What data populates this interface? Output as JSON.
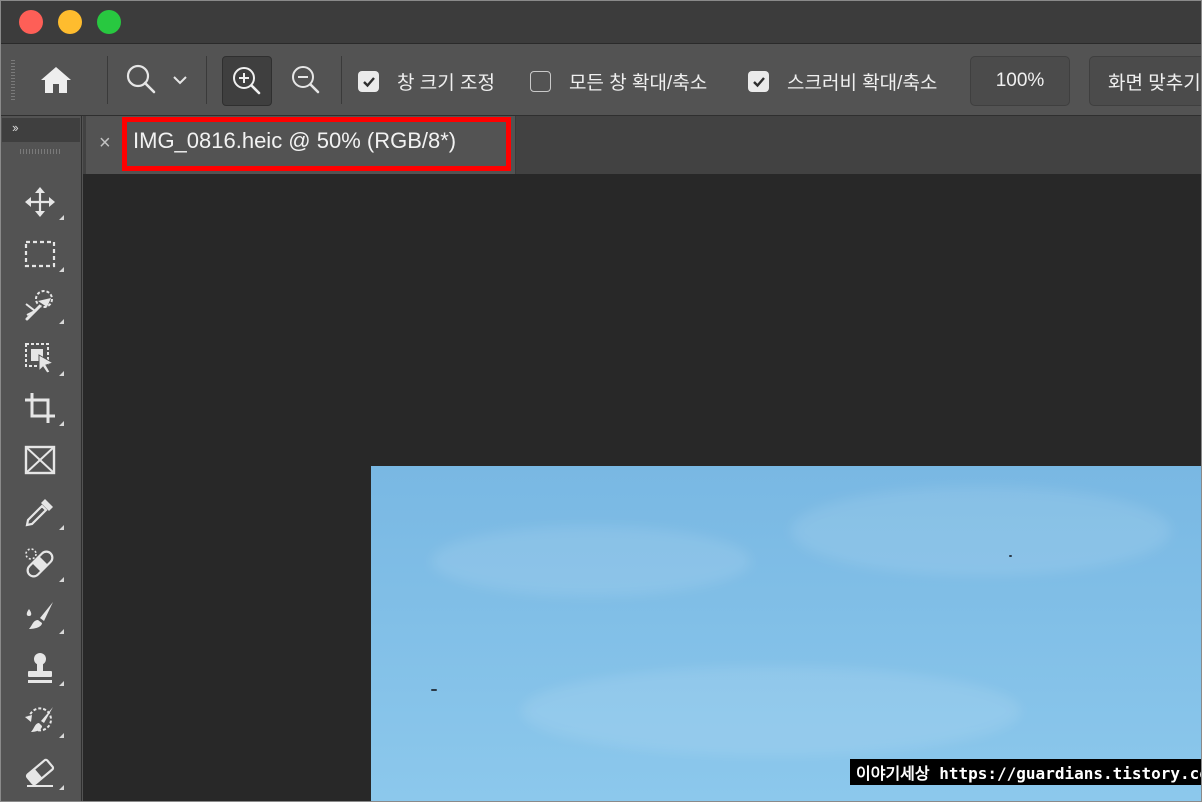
{
  "window": {
    "traffic_lights": [
      "close",
      "minimize",
      "maximize"
    ]
  },
  "options_bar": {
    "home_icon": "home-icon",
    "zoom_tool_icon": "magnifier-icon",
    "zoom_in_icon": "zoom-in-icon",
    "zoom_out_icon": "zoom-out-icon",
    "resize_windows_label": "창 크기 조정",
    "resize_windows_checked": true,
    "zoom_all_label": "모든 창 확대/축소",
    "zoom_all_checked": false,
    "scrubby_zoom_label": "스크러비 확대/축소",
    "scrubby_zoom_checked": true,
    "zoom_level_button": "100%",
    "fit_screen_button": "화면 맞추기"
  },
  "toolbar": {
    "collapse_label": "››",
    "tools": [
      "move-icon",
      "marquee-icon",
      "quick-selection-icon",
      "object-selection-icon",
      "crop-icon",
      "frame-icon",
      "eyedropper-icon",
      "healing-brush-icon",
      "brush-icon",
      "clone-stamp-icon",
      "history-brush-icon",
      "eraser-icon"
    ]
  },
  "document": {
    "tab_title": "IMG_0816.heic @ 50% (RGB/8*)",
    "tab_close": "×"
  },
  "watermark": {
    "text": "이야기세상 https://guardians.tistory.com"
  },
  "colors": {
    "highlight": "#ff0000",
    "panel": "#535353",
    "canvas_bg": "#282828",
    "sky": "#81bfe7"
  }
}
